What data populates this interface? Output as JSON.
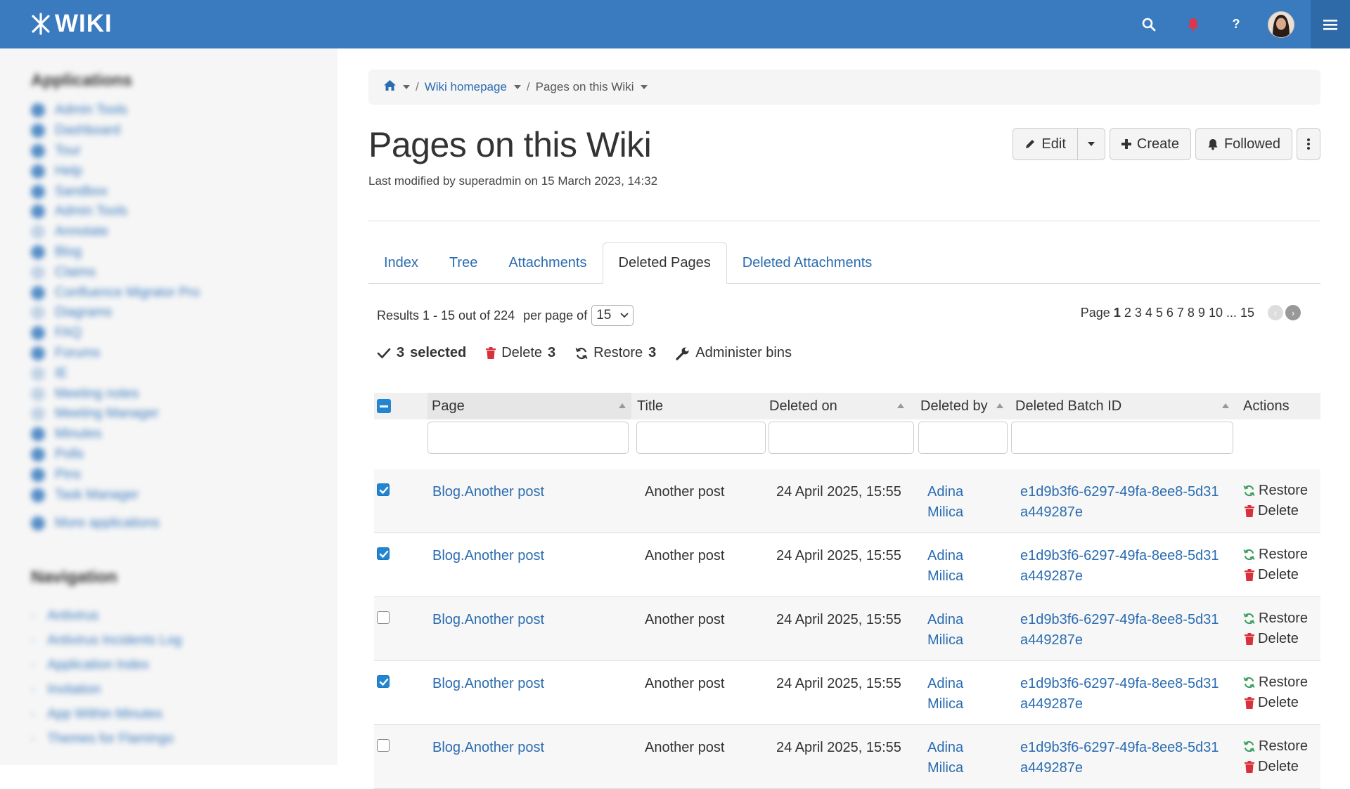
{
  "app": {
    "logo_text": "WIKI",
    "brand_color": "#3a7bbf"
  },
  "topbar": {
    "icons": [
      "search-icon",
      "bell-icon",
      "help-icon",
      "avatar",
      "menu-icon"
    ]
  },
  "sidebar": {
    "title_applications": "Applications",
    "applications": [
      "Admin Tools",
      "Dashboard",
      "Tour",
      "Help",
      "Sandbox",
      "Admin Tools",
      "Annotate",
      "Blog",
      "Claims",
      "Confluence Migrator Pro",
      "Diagrams",
      "FAQ",
      "Forums",
      "IE",
      "Meeting notes",
      "Meeting Manager",
      "Minutes",
      "Polls",
      "Pins",
      "Task Manager"
    ],
    "more_apps": "More applications",
    "title_navigation": "Navigation",
    "navigation": [
      "Antivirus",
      "Antivirus Incidents Log",
      "Application Index",
      "Invitation",
      "App Within Minutes",
      "Themes for Flamingo"
    ]
  },
  "breadcrumb": {
    "parent": "Wiki homepage",
    "current": "Pages on this Wiki"
  },
  "page": {
    "title": "Pages on this Wiki",
    "meta": "Last modified by superadmin on 15 March 2023, 14:32"
  },
  "actions": {
    "edit": "Edit",
    "create": "Create",
    "followed": "Followed"
  },
  "tabs": [
    "Index",
    "Tree",
    "Attachments",
    "Deleted Pages",
    "Deleted Attachments"
  ],
  "active_tab_index": 3,
  "results": {
    "text": "Results 1 - 15 out of 224",
    "per_page_label": "per page of",
    "per_page_value": "15",
    "page_label": "Page",
    "current_page": "1",
    "pages": "2 3 4 5 6 7 8 9 10 ... 15"
  },
  "bulk": {
    "selected_count": "3",
    "selected_label": "selected",
    "delete_label": "Delete",
    "delete_count": "3",
    "restore_label": "Restore",
    "restore_count": "3",
    "administer": "Administer bins"
  },
  "table": {
    "headers": {
      "page": "Page",
      "title": "Title",
      "deleted_on": "Deleted on",
      "deleted_by": "Deleted by",
      "batch_id": "Deleted Batch ID",
      "actions": "Actions"
    },
    "action_restore": "Restore",
    "action_delete": "Delete",
    "rows": [
      {
        "checked": true,
        "page": "Blog.Another post",
        "title": "Another post",
        "deleted_on": "24 April 2025, 15:55",
        "by_first": "Adina",
        "by_last": "Milica",
        "batch_1": "e1d9b3f6-6297-49fa-8ee8-5d31",
        "batch_2": "a449287e"
      },
      {
        "checked": true,
        "page": "Blog.Another post",
        "title": "Another post",
        "deleted_on": "24 April 2025, 15:55",
        "by_first": "Adina",
        "by_last": "Milica",
        "batch_1": "e1d9b3f6-6297-49fa-8ee8-5d31",
        "batch_2": "a449287e"
      },
      {
        "checked": false,
        "page": "Blog.Another post",
        "title": "Another post",
        "deleted_on": "24 April 2025, 15:55",
        "by_first": "Adina",
        "by_last": "Milica",
        "batch_1": "e1d9b3f6-6297-49fa-8ee8-5d31",
        "batch_2": "a449287e"
      },
      {
        "checked": true,
        "page": "Blog.Another post",
        "title": "Another post",
        "deleted_on": "24 April 2025, 15:55",
        "by_first": "Adina",
        "by_last": "Milica",
        "batch_1": "e1d9b3f6-6297-49fa-8ee8-5d31",
        "batch_2": "a449287e"
      },
      {
        "checked": false,
        "page": "Blog.Another post",
        "title": "Another post",
        "deleted_on": "24 April 2025, 15:55",
        "by_first": "Adina",
        "by_last": "Milica",
        "batch_1": "e1d9b3f6-6297-49fa-8ee8-5d31",
        "batch_2": "a449287e"
      }
    ]
  },
  "colors": {
    "link": "#2b6cb0",
    "checkbox": "#2185d0",
    "delete_red": "#d9303a",
    "restore_green": "#3a9e5c"
  }
}
